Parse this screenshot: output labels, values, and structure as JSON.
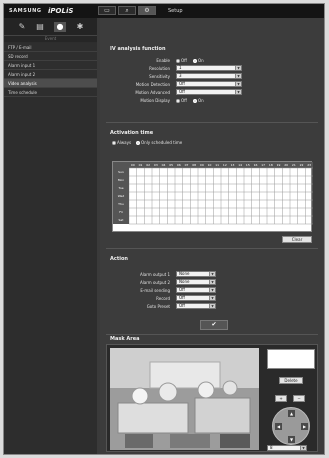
{
  "header": {
    "brand": "SAMSUNG",
    "product": "iPOLiS",
    "nav_icons": [
      "monitor-icon",
      "search-icon",
      "gear-icon"
    ],
    "active_label": "Setup"
  },
  "sidebar": {
    "icons": [
      "wrench-icon",
      "document-icon",
      "person-icon",
      "settings-icon"
    ],
    "section_label": "Event",
    "items": [
      {
        "label": "FTP / E-mail"
      },
      {
        "label": "SD record"
      },
      {
        "label": "Alarm input 1"
      },
      {
        "label": "Alarm input 2"
      },
      {
        "label": "Video analysis"
      },
      {
        "label": "Time schedule"
      }
    ],
    "active_index": 4
  },
  "iv_function": {
    "title": "IV analysis function",
    "enable": {
      "label": "Enable",
      "options": [
        "Off",
        "On"
      ],
      "selected": "On"
    },
    "resolution": {
      "label": "Resolution",
      "value": "1"
    },
    "sensitivity": {
      "label": "Sensitivity",
      "value": "3"
    },
    "motion_detection": {
      "label": "Motion Detection",
      "value": "Off"
    },
    "motion_advanced": {
      "label": "Motion Advanced",
      "value": "Off"
    },
    "motion_display": {
      "label": "Motion Display",
      "options": [
        "Off",
        "On"
      ],
      "selected": "On"
    }
  },
  "activation": {
    "title": "Activation time",
    "options": [
      "Always",
      "Only scheduled time"
    ],
    "selected": "Only scheduled time",
    "hours": [
      "00",
      "01",
      "02",
      "03",
      "04",
      "05",
      "06",
      "07",
      "08",
      "09",
      "10",
      "11",
      "12",
      "13",
      "14",
      "15",
      "16",
      "17",
      "18",
      "19",
      "20",
      "21",
      "22",
      "23"
    ],
    "days": [
      "Sun",
      "Mon",
      "Tue",
      "Wed",
      "Thu",
      "Fri",
      "Sat"
    ],
    "clear_label": "Clear"
  },
  "action": {
    "title": "Action",
    "rows": [
      {
        "label": "Alarm output 1",
        "value": "None"
      },
      {
        "label": "Alarm output 2",
        "value": "None"
      },
      {
        "label": "E-mail sending",
        "value": "Off"
      },
      {
        "label": "Record",
        "value": "Off"
      },
      {
        "label": "Goto Preset",
        "value": "Off"
      }
    ],
    "apply_symbol": "✔"
  },
  "mask_area": {
    "title": "Mask Area",
    "delete_label": "Delete",
    "zoom_in": "+",
    "zoom_out": "−",
    "arrows": {
      "up": "▲",
      "down": "▼",
      "left": "◀",
      "right": "▶"
    },
    "preset_value": "8"
  }
}
